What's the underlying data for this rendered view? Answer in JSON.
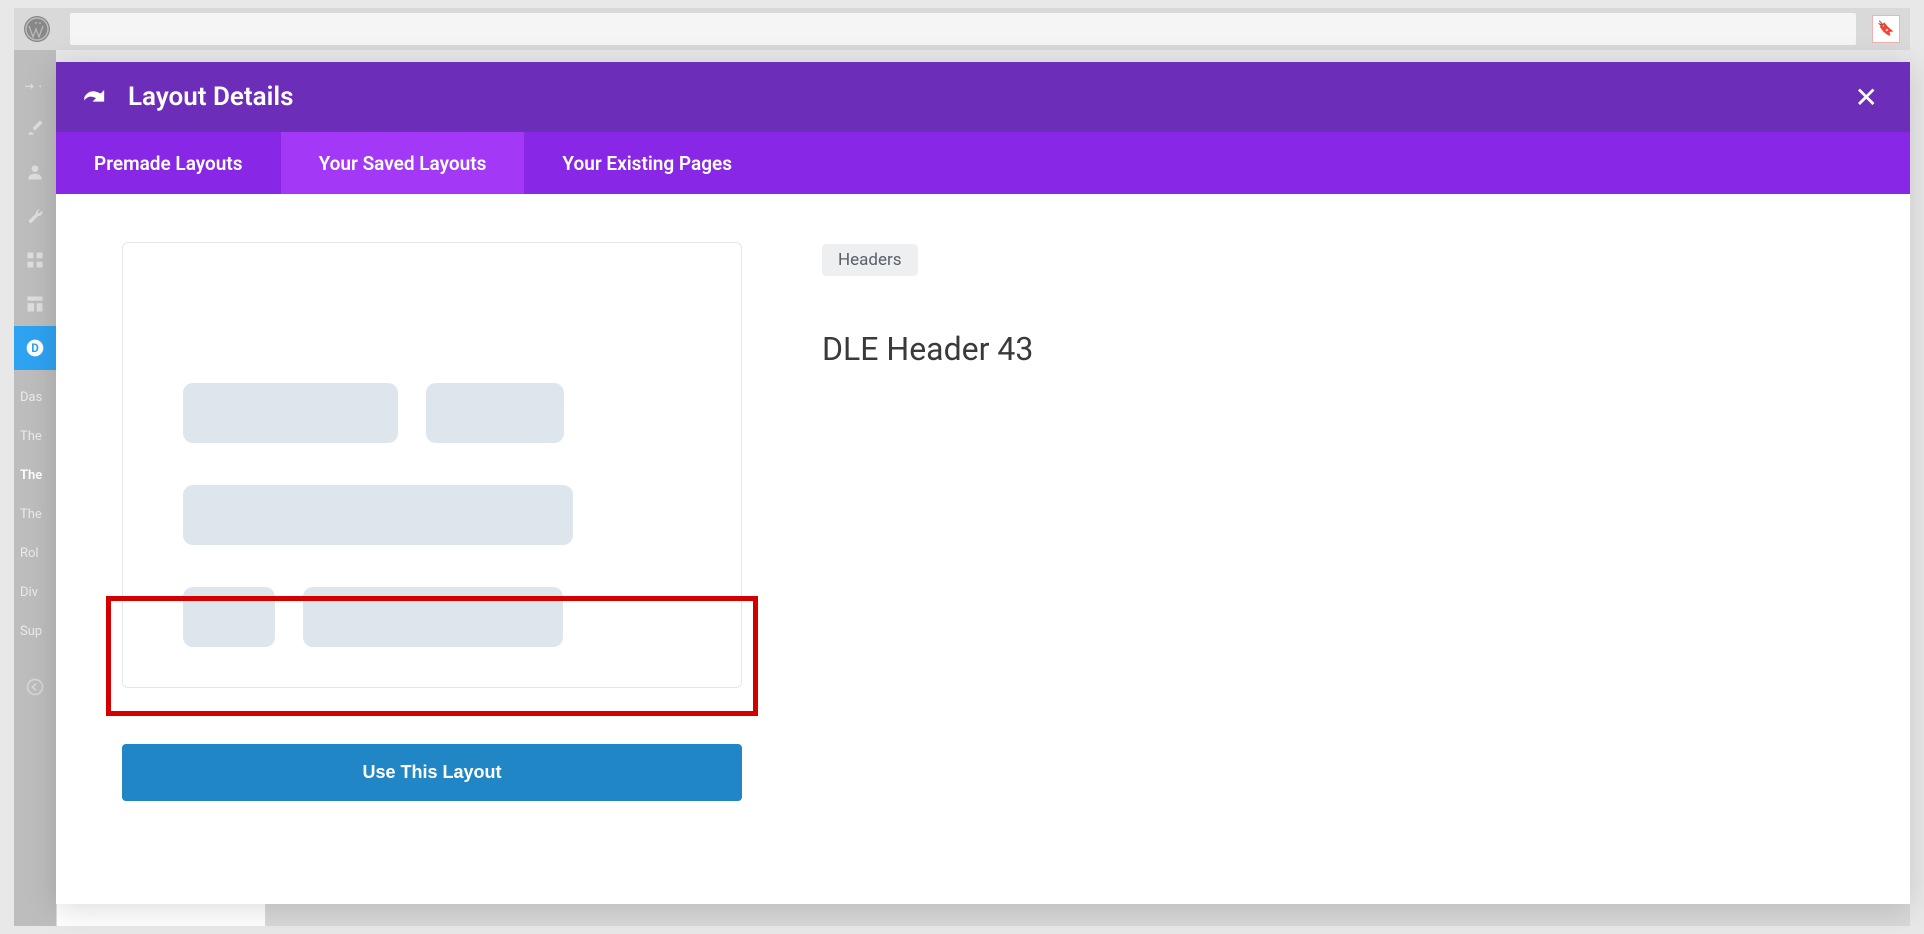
{
  "admin_bar": {
    "wp_logo": "wordpress"
  },
  "sidebar": {
    "icons": [
      {
        "name": "pin-icon"
      },
      {
        "name": "brush-icon"
      },
      {
        "name": "user-icon"
      },
      {
        "name": "wrench-icon"
      },
      {
        "name": "grid-icon"
      },
      {
        "name": "layout-icon"
      }
    ],
    "active_icon": "divi-icon",
    "text_items": [
      {
        "label": "Das"
      },
      {
        "label": "The"
      },
      {
        "label": "The",
        "active": true
      },
      {
        "label": "The"
      },
      {
        "label": "Rol"
      },
      {
        "label": "Div"
      },
      {
        "label": "Sup"
      }
    ]
  },
  "modal": {
    "title": "Layout Details",
    "close_label": "✕",
    "tabs": [
      {
        "label": "Premade Layouts",
        "active": false
      },
      {
        "label": "Your Saved Layouts",
        "active": true
      },
      {
        "label": "Your Existing Pages",
        "active": false
      }
    ],
    "use_button_label": "Use This Layout",
    "category_tag": "Headers",
    "layout_name": "DLE Header 43"
  }
}
